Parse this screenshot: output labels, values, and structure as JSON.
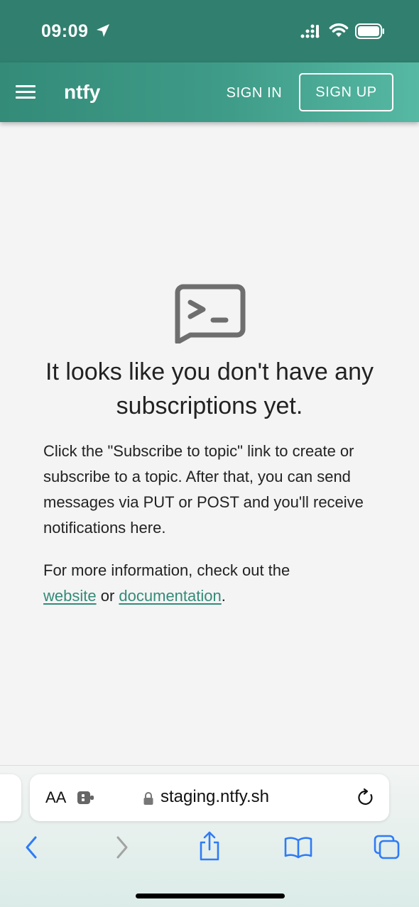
{
  "status_bar": {
    "time": "09:09",
    "icons": [
      "location-arrow-icon",
      "cellular-signal-icon",
      "wifi-icon",
      "battery-icon"
    ]
  },
  "app_bar": {
    "menu_icon": "hamburger-menu-icon",
    "title": "ntfy",
    "sign_in_label": "SIGN IN",
    "sign_up_label": "SIGN UP",
    "colors": {
      "start": "#338b78",
      "end": "#56b9a3"
    }
  },
  "empty_state": {
    "icon": "terminal-chat-icon",
    "title": "It looks like you don't have any subscriptions yet.",
    "description": "Click the \"Subscribe to topic\" link to create or subscribe to a topic. After that, you can send messages via PUT or POST and you'll receive notifications here.",
    "more_info_prefix": "For more information, check out the",
    "website_link": "website",
    "or_text": "or",
    "documentation_link": "documentation",
    "suffix": ".",
    "link_color": "#338b78"
  },
  "safari": {
    "text_size_label": "AA",
    "extension_icon": "puzzle-extension-icon",
    "lock_icon": "lock-icon",
    "url": "staging.ntfy.sh",
    "reload_icon": "reload-icon",
    "toolbar": {
      "back_icon": "chevron-left-icon",
      "forward_icon": "chevron-right-icon",
      "share_icon": "share-icon",
      "bookmarks_icon": "book-icon",
      "tabs_icon": "tabs-icon"
    }
  }
}
